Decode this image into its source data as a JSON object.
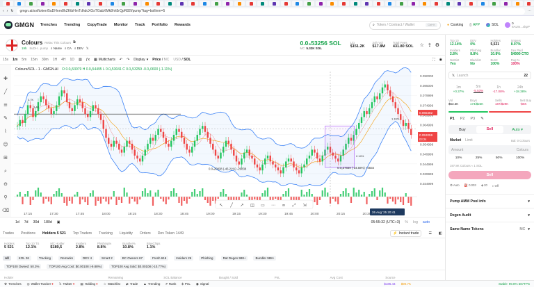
{
  "browser": {
    "url": "gmgn.ai/sol/token/5uDHnrn8hZKtbHmTdhdcXGsTGabXMk8hh5rQpR82f/pump?tag=bollinm=5",
    "tabs_count": 46
  },
  "nav": {
    "brand": "GMGN",
    "items": [
      "Trenches",
      "Trending",
      "CopyTrade",
      "Monitor",
      "Track",
      "Portfolio",
      "Rewards"
    ],
    "search_placeholder": "Token / Contract / Wallet",
    "ctrl_k": "Ctrl+K",
    "cooking": "Cooking",
    "cooking_badge": "New",
    "app": "APP",
    "chain": "SOL",
    "balance": "0",
    "wallet_short": "8AUm...4kpP"
  },
  "token": {
    "name": "Colours",
    "subtitle": "Relax This Colours",
    "age": "19h",
    "holders": "8",
    "ca": "8uDH...pump",
    "links": [
      "Name",
      "CA",
      "DEV"
    ],
    "price": "0.0₅53256 SOL",
    "mc_label": "MC",
    "mc": "5.32K SOL",
    "liq_label": "Liq",
    "liq": "$151.2K",
    "vol_label": "24h Vol",
    "vol": "$17.8M",
    "supply_label": "Total Fees",
    "supply": "431.80 SOL"
  },
  "toolbar": {
    "intervals": [
      "15s",
      "1m",
      "5m",
      "15m",
      "30m",
      "1H",
      "4H",
      "1D"
    ],
    "active": "1m",
    "multicharts": "Multicharts",
    "display": "Display",
    "price_toggle": "Price",
    "mc_toggle": "MC",
    "usd": "USD",
    "sol": "SOL"
  },
  "chart": {
    "legend": "Colours/SOL - 1 - GMGN.AI",
    "ohlc": "O 0.0₅53079 H 0.0₅54495 L 0.0₅53041 C 0.0₅53259 -0.0₅0600 (-1.11%)",
    "y_ticks": [
      "0.090000",
      "0.085000",
      "0.079999",
      "0.074999",
      "0.069999",
      "0.064999",
      "0.059999",
      "0.054999",
      "0.049999",
      "0.044999",
      "0.039999",
      "0.034999"
    ],
    "x_ticks": [
      "17:15",
      "17:30",
      "17:45",
      "18:00",
      "18:15",
      "18:30",
      "18:45",
      "19:00",
      "19:15",
      "19:30",
      "19:45",
      "20:00",
      "20:15",
      "20:30",
      "20:45"
    ],
    "price_label": "0.065482",
    "price_label2": "0.053259",
    "price_label3": "03:24",
    "callout1": "0.0₅20838 (-46.21%) -20838",
    "callout2": "0.0₅37659 (-34.68%) +3834",
    "pct1": "3.7K",
    "pct2": "3.4K",
    "pct3": "2.14%",
    "pct4": "1.16%",
    "date_badge": "26 Aug '25   20:41",
    "candles": [
      56,
      58,
      57,
      60,
      63,
      62,
      59,
      61,
      64,
      66,
      65,
      63,
      62,
      60,
      61,
      63,
      66,
      68,
      67,
      64,
      62,
      61,
      63,
      65,
      64,
      62,
      60,
      59,
      61,
      63,
      62,
      60,
      58,
      55,
      52,
      50,
      49,
      51,
      50,
      48,
      47,
      49,
      51,
      50,
      48,
      46,
      45,
      44,
      46,
      48,
      50,
      52,
      51,
      53,
      55,
      54,
      52,
      50,
      49,
      51,
      53,
      55,
      54,
      52,
      50,
      48,
      47,
      49,
      51,
      53,
      55,
      56,
      54,
      52,
      50,
      48,
      46,
      45,
      47,
      49,
      51,
      50,
      48,
      46,
      44,
      43,
      45,
      47,
      48,
      46,
      45,
      43,
      42,
      41,
      43,
      45,
      46,
      44,
      43,
      42,
      41,
      40,
      42,
      44,
      45,
      44,
      42,
      41,
      40,
      42,
      43,
      45,
      46,
      48,
      47,
      45,
      44,
      46,
      48,
      49,
      47,
      46,
      45,
      44,
      46,
      48,
      50,
      52,
      51,
      53,
      55,
      57,
      59,
      61,
      60,
      62,
      64,
      66,
      65,
      67,
      69,
      70,
      68,
      66,
      64,
      62,
      60,
      58,
      56,
      57,
      55,
      53
    ]
  },
  "timebar": {
    "ranges": [
      "1d",
      "7d",
      "30d",
      "180d"
    ],
    "clock": "05:55:32 (UTC+3)",
    "pct": "%",
    "log": "log",
    "auto": "auto"
  },
  "holders": {
    "tabs": [
      "Trades",
      "Positions",
      "Holders 5 521",
      "Top Traders",
      "Tracking",
      "Liquidity",
      "Orders",
      "Dev Token 1449"
    ],
    "instant": "Instant trade",
    "stats": [
      {
        "k": "Holders",
        "v": "5 521"
      },
      {
        "k": "Top 10 TS",
        "v": "12.1%"
      },
      {
        "k": "MC Holder",
        "v": "$189,5"
      },
      {
        "k": "Insiders",
        "v": "2.8%"
      },
      {
        "k": "Phishing%",
        "v": "8.8%"
      },
      {
        "k": "Bundler%",
        "v": "10.8%"
      },
      {
        "k": "BlueChips",
        "v": "1.1%"
      }
    ],
    "filters": [
      "All",
      "KOL 26",
      "Tracking",
      "Remarks",
      "DEV 4",
      "Smart 2",
      "BC Owners 67",
      "Fresh 616",
      "Insiders 26",
      "Phishing",
      "Rat Degen 988+",
      "Bundler 988+"
    ],
    "top": [
      "TOP100 Owned: 50.3%",
      "TOP100 Avg Cost: $0.00108 (-9.88%)",
      "TOP100 Avg Sold: $0.00108 (-10.77%)"
    ],
    "cols": [
      "Holder",
      "Remaining",
      "SOL Balance",
      "Bought / Sold",
      "PnL",
      "Avg Cost",
      "Source"
    ]
  },
  "right": {
    "top10_label": "Top 10",
    "top10": "12.14%",
    "dev_label": "DEV",
    "dev": "0%",
    "holders_label": "Holders",
    "holders": "5,521",
    "snipers_label": "Snipers",
    "snipers": "8.07%",
    "insiders_label": "Insiders",
    "insiders": "2.8%",
    "phishing_label": "Phishing",
    "phishing": "8.8%",
    "bundler_label": "Bundler",
    "bundler": "10.8%",
    "dexpaid_label": "Dex Paid",
    "dexpaid": "$4990 CTO",
    "nomint_label": "NoMint",
    "nomint": "Yes",
    "blacklist_label": "Blacklist",
    "blacklist": "No",
    "burnt_label": "Burnt",
    "burnt": "100%",
    "rug_label": "Rug %",
    "rug": "100%",
    "launch": "Launch",
    "launch_n": "22",
    "periods": [
      {
        "k": "1m",
        "v": "+0.37%"
      },
      {
        "k": "5m",
        "v": "-5.53%"
      },
      {
        "k": "1h",
        "v": "-17.08%"
      },
      {
        "k": "24h",
        "v": "+18.38%"
      }
    ],
    "vol_label": "Vol",
    "vol": "$53.3K",
    "buys_label": "Buys",
    "buys": "174/$23K",
    "sells_label": "Sells",
    "sells": "187/$29K",
    "netbuy_label": "Net Buy",
    "netbuy": "-$6K",
    "presets": [
      "P1",
      "P2",
      "P3"
    ],
    "buy": "Buy",
    "sell": "Sell",
    "auto": "Auto",
    "market": "Market",
    "limit": "Limit",
    "bal": "Bal: 0 Colours",
    "amount": "Amount",
    "amount_unit": "Colours",
    "pcts": [
      "10%",
      "25%",
      "50%",
      "100%"
    ],
    "conv": "197.8K Colours ≈ 1 SOL",
    "sell_btn": "Sell",
    "auto_opts": [
      "Auto",
      "0.003",
      "20",
      "Off"
    ],
    "sections": [
      "Pump AMM Pool info",
      "Degen Audit",
      "Same Name Tokens"
    ],
    "mc_sort": "MC"
  },
  "footer": {
    "items": [
      "Trenches",
      "Wallet Tracker",
      "Twitter",
      "Holding",
      "Watchlist",
      "Trade",
      "Trending",
      "Rank",
      "PnL",
      "Signal"
    ],
    "sol_price": "$186.44",
    "btc": "$90.7K",
    "stable": "Stable",
    "latency": "99.8% 587TPS"
  },
  "colors": {
    "up": "#22c55e",
    "down": "#ef4444",
    "accent": "#16a34a",
    "pink": "#e0245e",
    "bb": "#3b82f6"
  }
}
